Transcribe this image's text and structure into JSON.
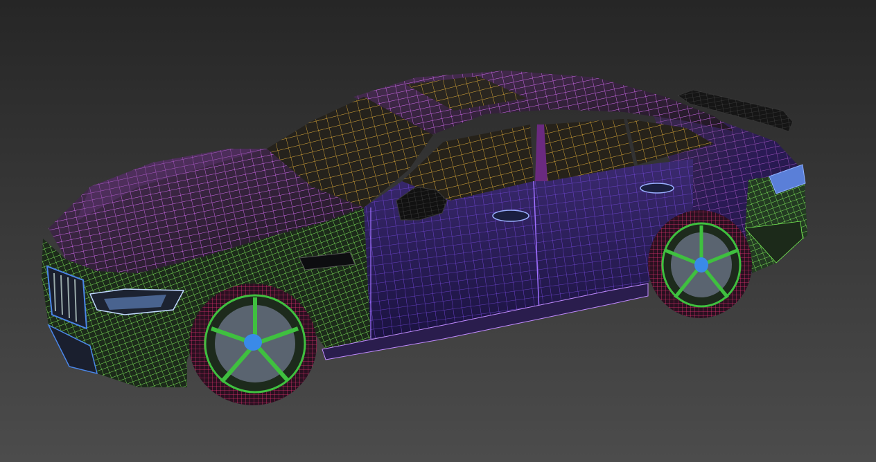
{
  "viewport": {
    "background_top": "#2a2a2a",
    "background_bottom": "#4a4a4a",
    "render_mode": "wireframe-on-shaded"
  },
  "model": {
    "object": "car",
    "parts": [
      {
        "name": "hood-and-roof",
        "wire_color": "#cc55ee"
      },
      {
        "name": "front-bumper-and-fenders",
        "wire_color": "#77ee55"
      },
      {
        "name": "doors-and-sides",
        "wire_color": "#7733dd"
      },
      {
        "name": "interior-and-glass",
        "wire_color": "#ddaa33"
      },
      {
        "name": "tires",
        "wire_color": "#dd2266"
      },
      {
        "name": "rims",
        "wire_color": "#44cc44"
      },
      {
        "name": "trim-and-grille",
        "wire_color": "#4488ee"
      },
      {
        "name": "rear-spoiler",
        "wire_color": "#111111"
      }
    ]
  }
}
